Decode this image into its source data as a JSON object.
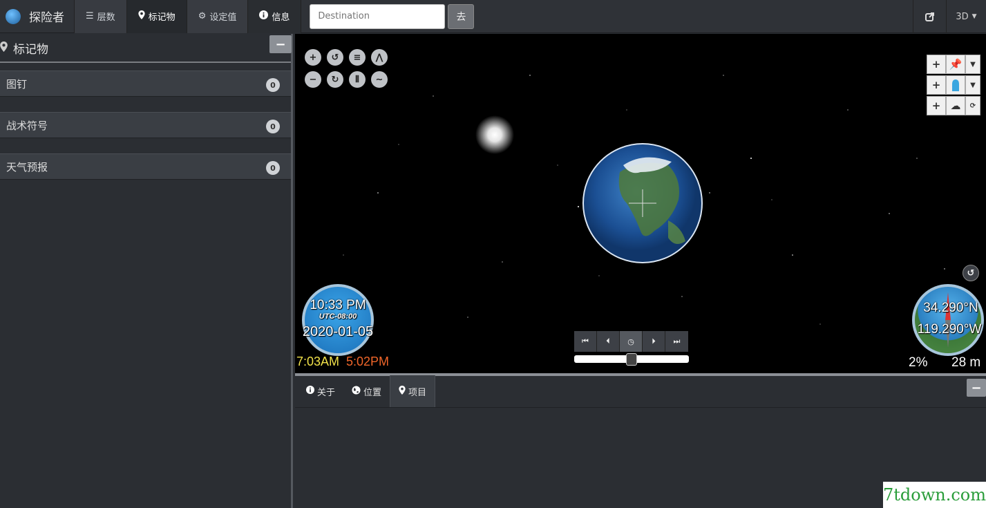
{
  "app": {
    "title": "探险者"
  },
  "nav": {
    "tabs": [
      {
        "label": "层数",
        "icon": "list-icon"
      },
      {
        "label": "标记物",
        "icon": "map-marker-icon"
      },
      {
        "label": "设定值",
        "icon": "gear-icon"
      },
      {
        "label": "信息",
        "icon": "info-icon"
      }
    ],
    "active_tab": "标记物"
  },
  "search": {
    "placeholder": "Destination",
    "go_label": "去"
  },
  "top_right": {
    "mode_label": "3D"
  },
  "sidebar": {
    "title": "标记物",
    "collapse_label": "−",
    "groups": [
      {
        "label": "图钉",
        "count": "0"
      },
      {
        "label": "战术符号",
        "count": "0"
      },
      {
        "label": "天气预报",
        "count": "0"
      }
    ]
  },
  "viewer": {
    "clock": {
      "time": "10:33 PM",
      "timezone": "UTC-08:00",
      "date": "2020-01-05",
      "sunrise": "7:03AM",
      "sunset": "5:02PM"
    },
    "compass": {
      "lat": "34.290°N",
      "lon": "119.290°W"
    },
    "status": {
      "percent": "2%",
      "altitude": "28 m"
    },
    "timeline_slider_position": 0.5
  },
  "bottom": {
    "tabs": [
      {
        "label": "关于",
        "icon": "info-icon"
      },
      {
        "label": "位置",
        "icon": "globe-icon"
      },
      {
        "label": "项目",
        "icon": "map-marker-icon"
      }
    ],
    "active_tab": "项目",
    "collapse_label": "−"
  },
  "watermark": "7tdown.com",
  "colors": {
    "sunrise": "#f2e24a",
    "sunset": "#f0662a"
  }
}
